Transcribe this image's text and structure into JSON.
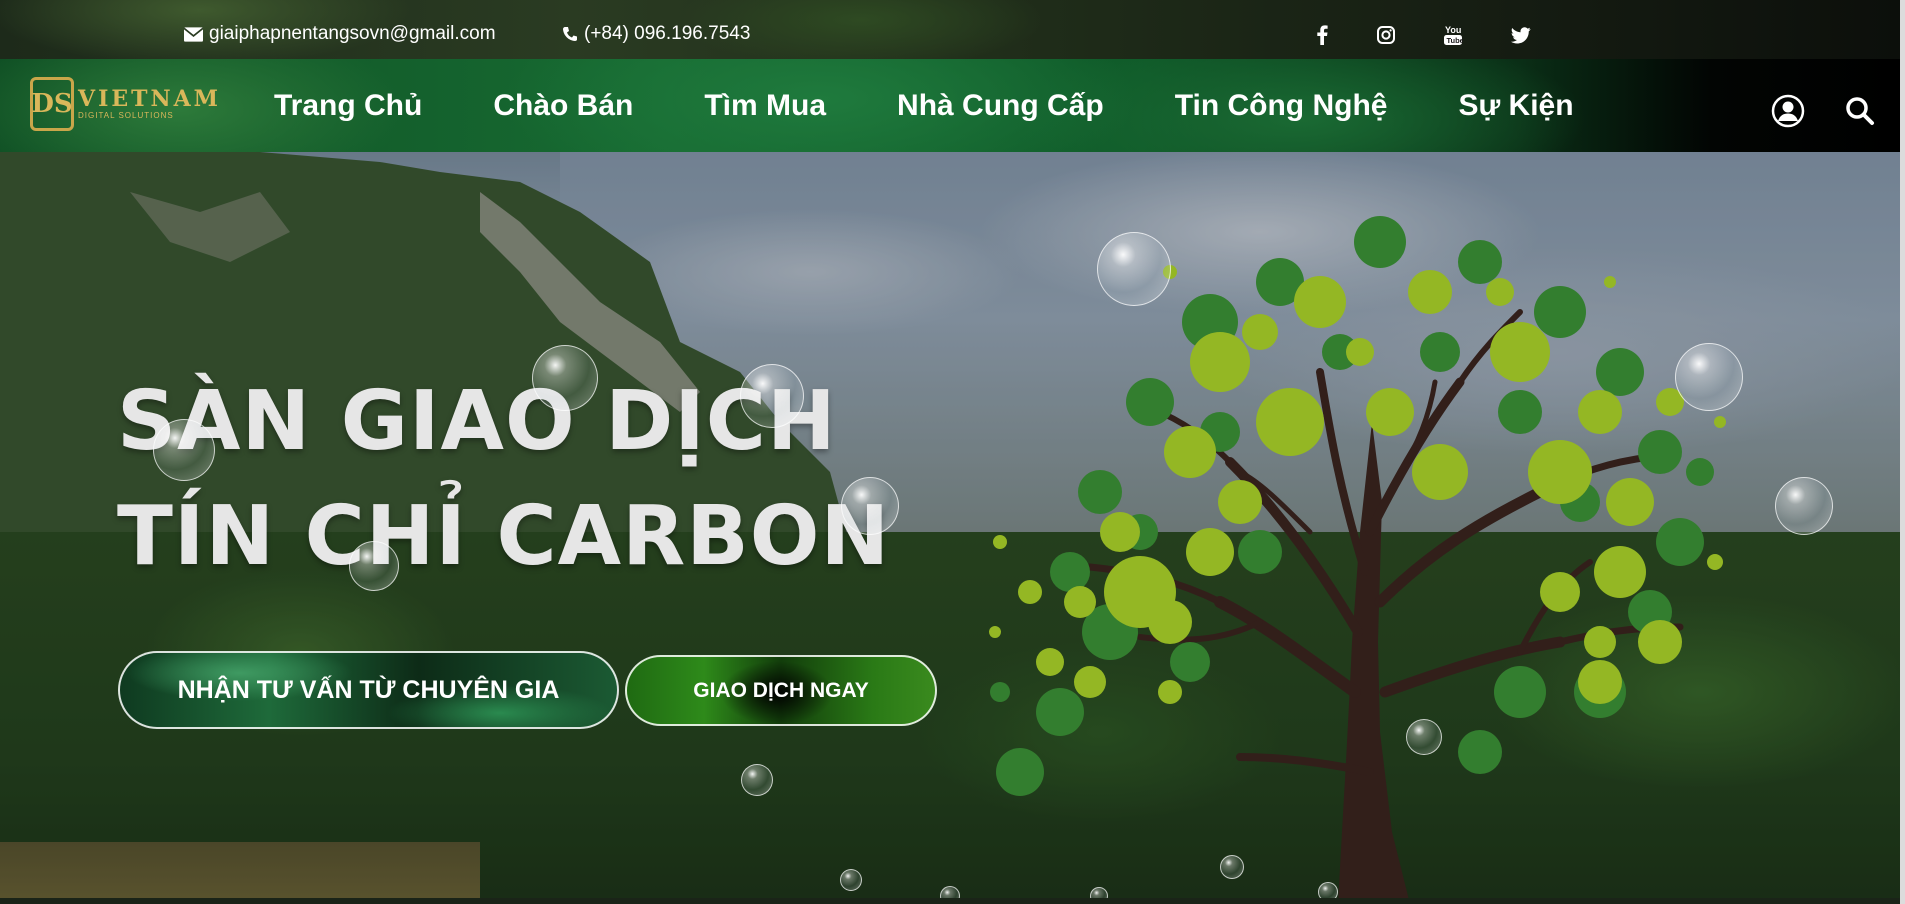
{
  "topbar": {
    "email": "giaiphapnentangsovn@gmail.com",
    "phone": "(+84) 096.196.7543",
    "social": [
      "facebook-icon",
      "instagram-icon",
      "youtube-icon",
      "twitter-icon"
    ]
  },
  "logo": {
    "mark": "DS",
    "name": "VIETNAM",
    "tagline": "DIGITAL SOLUTIONS"
  },
  "nav": {
    "items": [
      {
        "label": "Trang Chủ"
      },
      {
        "label": "Chào Bán"
      },
      {
        "label": "Tìm Mua"
      },
      {
        "label": "Nhà Cung Cấp"
      },
      {
        "label": "Tin Công Nghệ"
      },
      {
        "label": "Sự Kiện"
      }
    ],
    "icons": [
      "user-icon",
      "search-icon"
    ]
  },
  "hero": {
    "title_line1": "SÀN GIAO DỊCH",
    "title_line2": "TÍN CHỈ CARBON",
    "primary_button": "NHẬN TƯ VẤN TỪ CHUYÊN GIA",
    "secondary_button": "GIAO DỊCH NGAY"
  },
  "colors": {
    "nav_green": "#176b32",
    "leaf_light": "#b5e02c",
    "leaf_dark": "#3f9a3a",
    "trunk": "#3e2620",
    "logo_gold": "#d9b75a"
  }
}
